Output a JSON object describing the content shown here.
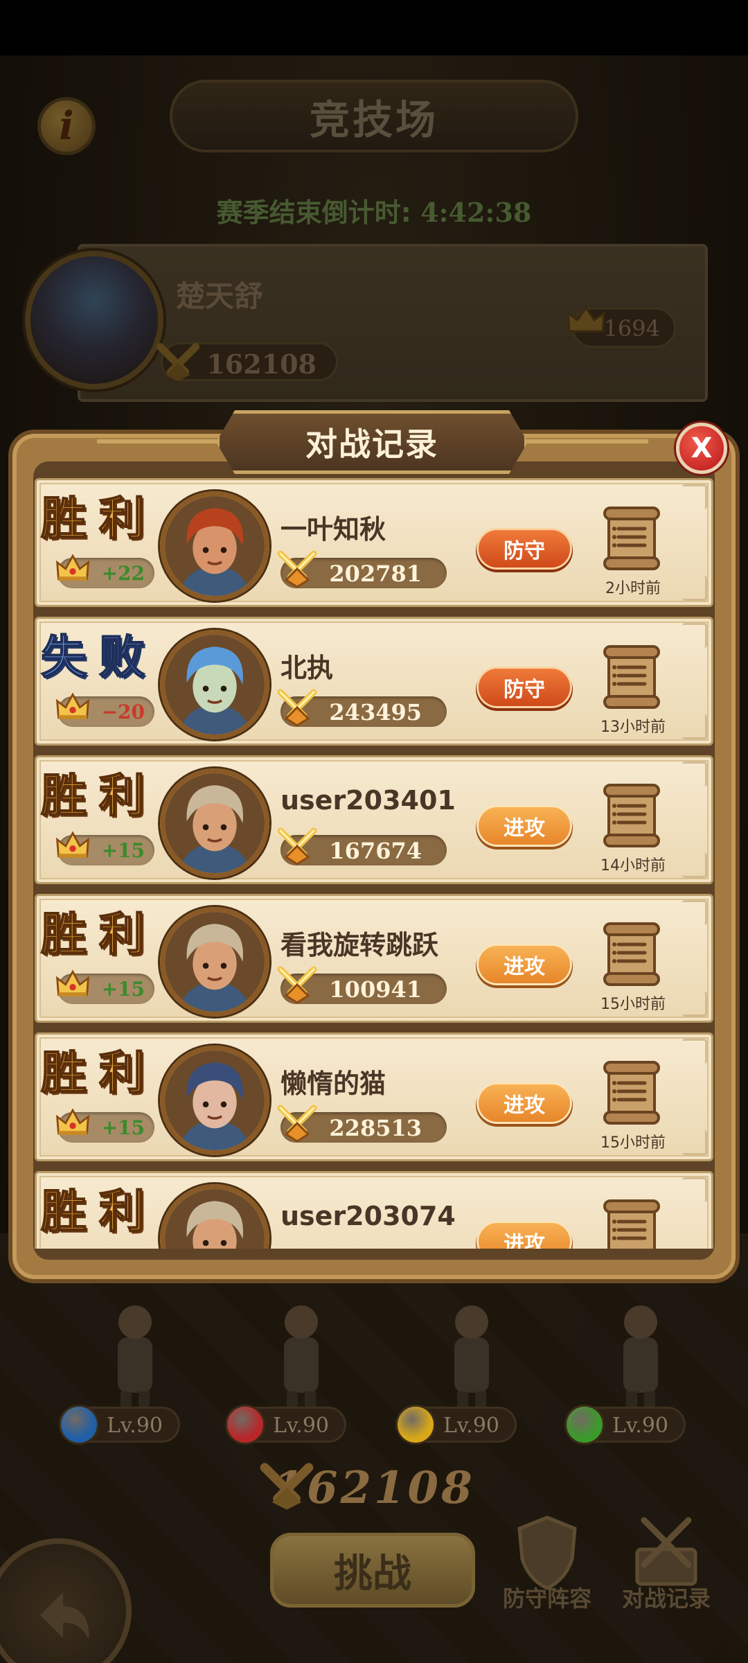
{
  "header": {
    "title": "竞技场",
    "info_glyph": "i",
    "countdown_label": "赛季结束倒计时: ",
    "countdown_value": "4:42:38"
  },
  "player": {
    "name": "楚天舒",
    "power": "162108",
    "trophies": "1694"
  },
  "modal": {
    "title": "对战记录",
    "close_label": "X"
  },
  "records": [
    {
      "result": "胜利",
      "outcome": "win",
      "trophy_delta": "+22",
      "name": "一叶知秋",
      "power": "202781",
      "type": "防守",
      "type_kind": "defend",
      "time_ago": "2小时前",
      "avatar_hair": "#b8421e",
      "avatar_skin": "#d9936a"
    },
    {
      "result": "失败",
      "outcome": "lose",
      "trophy_delta": "−20",
      "name": "北执",
      "power": "243495",
      "type": "防守",
      "type_kind": "defend",
      "time_ago": "13小时前",
      "avatar_hair": "#5a9ad8",
      "avatar_skin": "#c7d9b8"
    },
    {
      "result": "胜利",
      "outcome": "win",
      "trophy_delta": "+15",
      "name": "user203401",
      "power": "167674",
      "type": "进攻",
      "type_kind": "attack",
      "time_ago": "14小时前",
      "avatar_hair": "#c9b79a",
      "avatar_skin": "#d9a077"
    },
    {
      "result": "胜利",
      "outcome": "win",
      "trophy_delta": "+15",
      "name": "看我旋转跳跃",
      "power": "100941",
      "type": "进攻",
      "type_kind": "attack",
      "time_ago": "15小时前",
      "avatar_hair": "#c9b79a",
      "avatar_skin": "#d9a077"
    },
    {
      "result": "胜利",
      "outcome": "win",
      "trophy_delta": "+15",
      "name": "懒惰的猫",
      "power": "228513",
      "type": "进攻",
      "type_kind": "attack",
      "time_ago": "15小时前",
      "avatar_hair": "#3a4e7a",
      "avatar_skin": "#e2b8a0"
    },
    {
      "result": "胜利",
      "outcome": "win",
      "trophy_delta": "",
      "name": "user203074",
      "power": "",
      "type": "进攻",
      "type_kind": "attack",
      "time_ago": "",
      "avatar_hair": "#c9b79a",
      "avatar_skin": "#d9a077"
    }
  ],
  "team": {
    "heroes": [
      {
        "level": "Lv.90",
        "gem_color": "#1f5fa8"
      },
      {
        "level": "Lv.90",
        "gem_color": "#b8262a"
      },
      {
        "level": "Lv.90",
        "gem_color": "#d8a818"
      },
      {
        "level": "Lv.90",
        "gem_color": "#3a9a2a"
      }
    ],
    "power": "162108"
  },
  "buttons": {
    "challenge": "挑战",
    "defense_lineup": "防守阵容",
    "battle_records": "对战记录"
  },
  "colors": {
    "win_text": "#f1b53c",
    "lose_text": "#6e9be0",
    "defend_badge": "#e0602a",
    "attack_badge": "#f09a3e"
  }
}
